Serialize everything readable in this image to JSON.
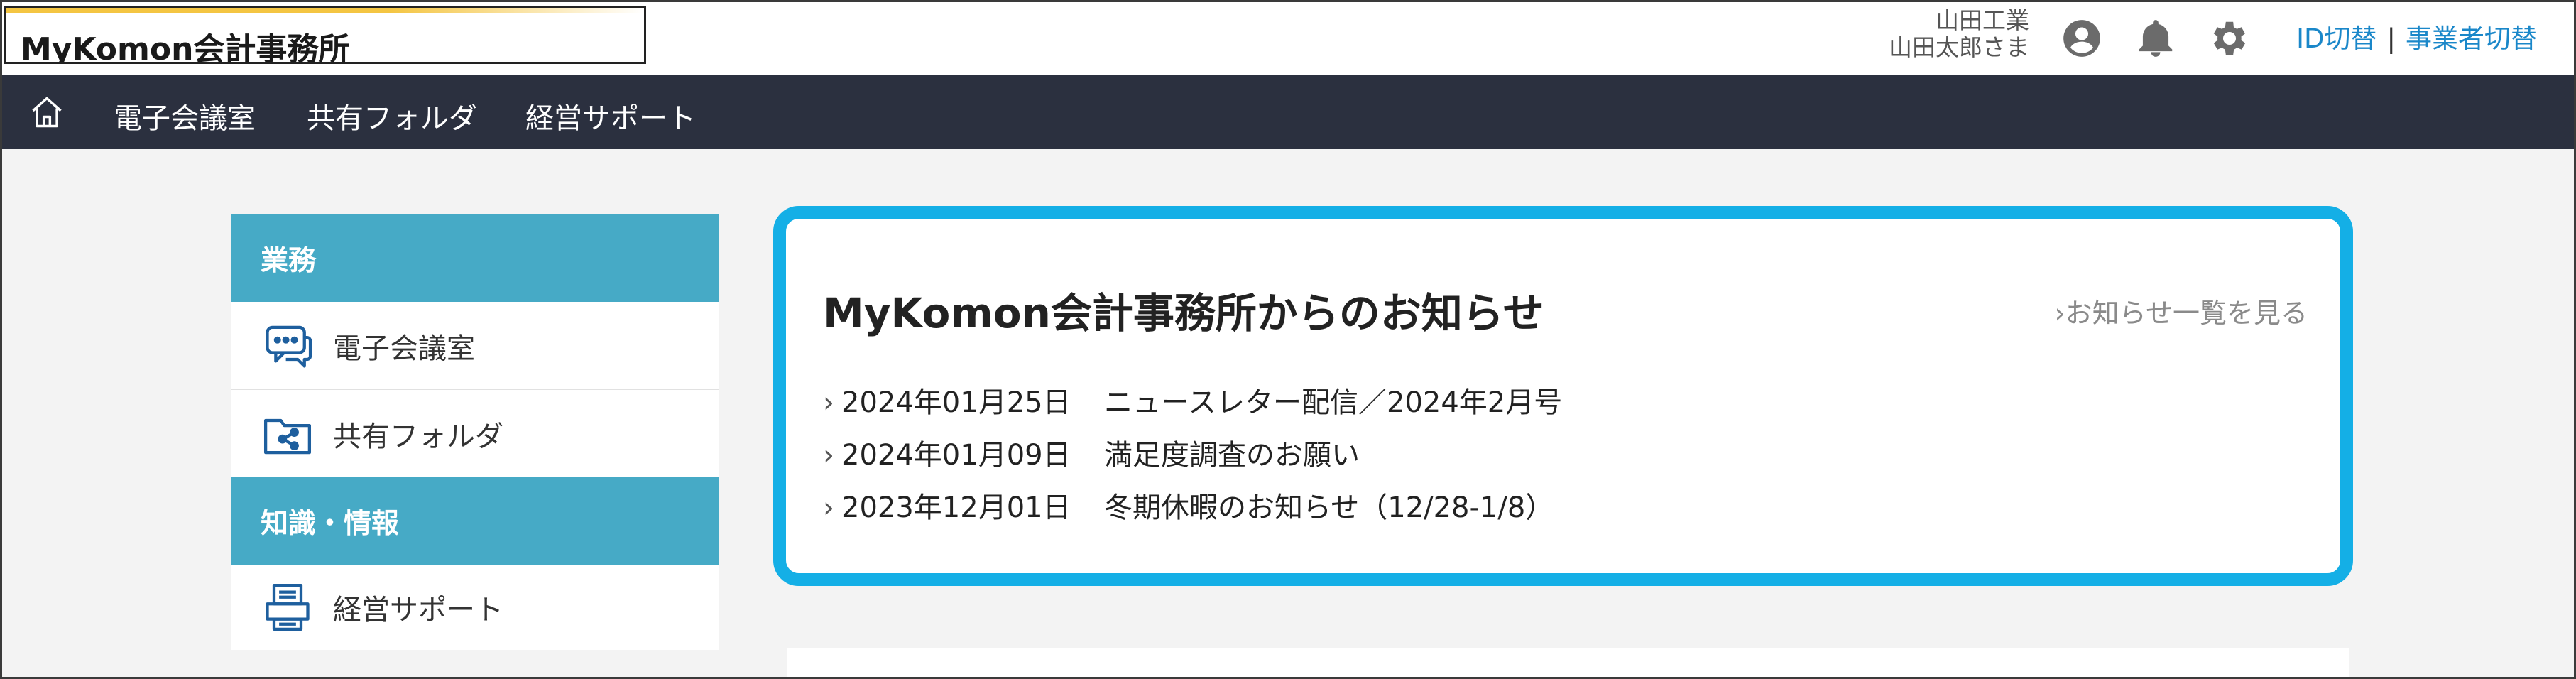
{
  "header": {
    "logo_text": "MyKomon会計事務所",
    "company_name": "山田工業",
    "user_name": "山田太郎さま",
    "icons": [
      "user-circle-icon",
      "bell-icon",
      "gear-icon"
    ],
    "link_id_switch": "ID切替",
    "link_separator": "|",
    "link_business_switch": "事業者切替",
    "accent_color": "#1a87c9"
  },
  "navbar": {
    "home_icon": "home-icon",
    "items": [
      {
        "label": "電子会議室"
      },
      {
        "label": "共有フォルダ"
      },
      {
        "label": "経営サポート"
      }
    ],
    "background": "#2b303f"
  },
  "sidebar": {
    "sections": [
      {
        "heading": "業務",
        "items": [
          {
            "label": "電子会議室",
            "icon": "chat-bubbles-icon"
          },
          {
            "label": "共有フォルダ",
            "icon": "shared-folder-icon"
          }
        ]
      },
      {
        "heading": "知識・情報",
        "items": [
          {
            "label": "経営サポート",
            "icon": "printer-icon"
          }
        ]
      }
    ],
    "heading_color": "#46aac6"
  },
  "news": {
    "title": "MyKomon会計事務所からのお知らせ",
    "more_link": "お知らせ一覧を見る",
    "border_color": "#14afe6",
    "items": [
      {
        "date": "2024年01月25日",
        "text": "ニュースレター配信／2024年2月号"
      },
      {
        "date": "2024年01月09日",
        "text": "満足度調査のお願い"
      },
      {
        "date": "2023年12月01日",
        "text": "冬期休暇のお知らせ（12/28-1/8）"
      }
    ]
  }
}
